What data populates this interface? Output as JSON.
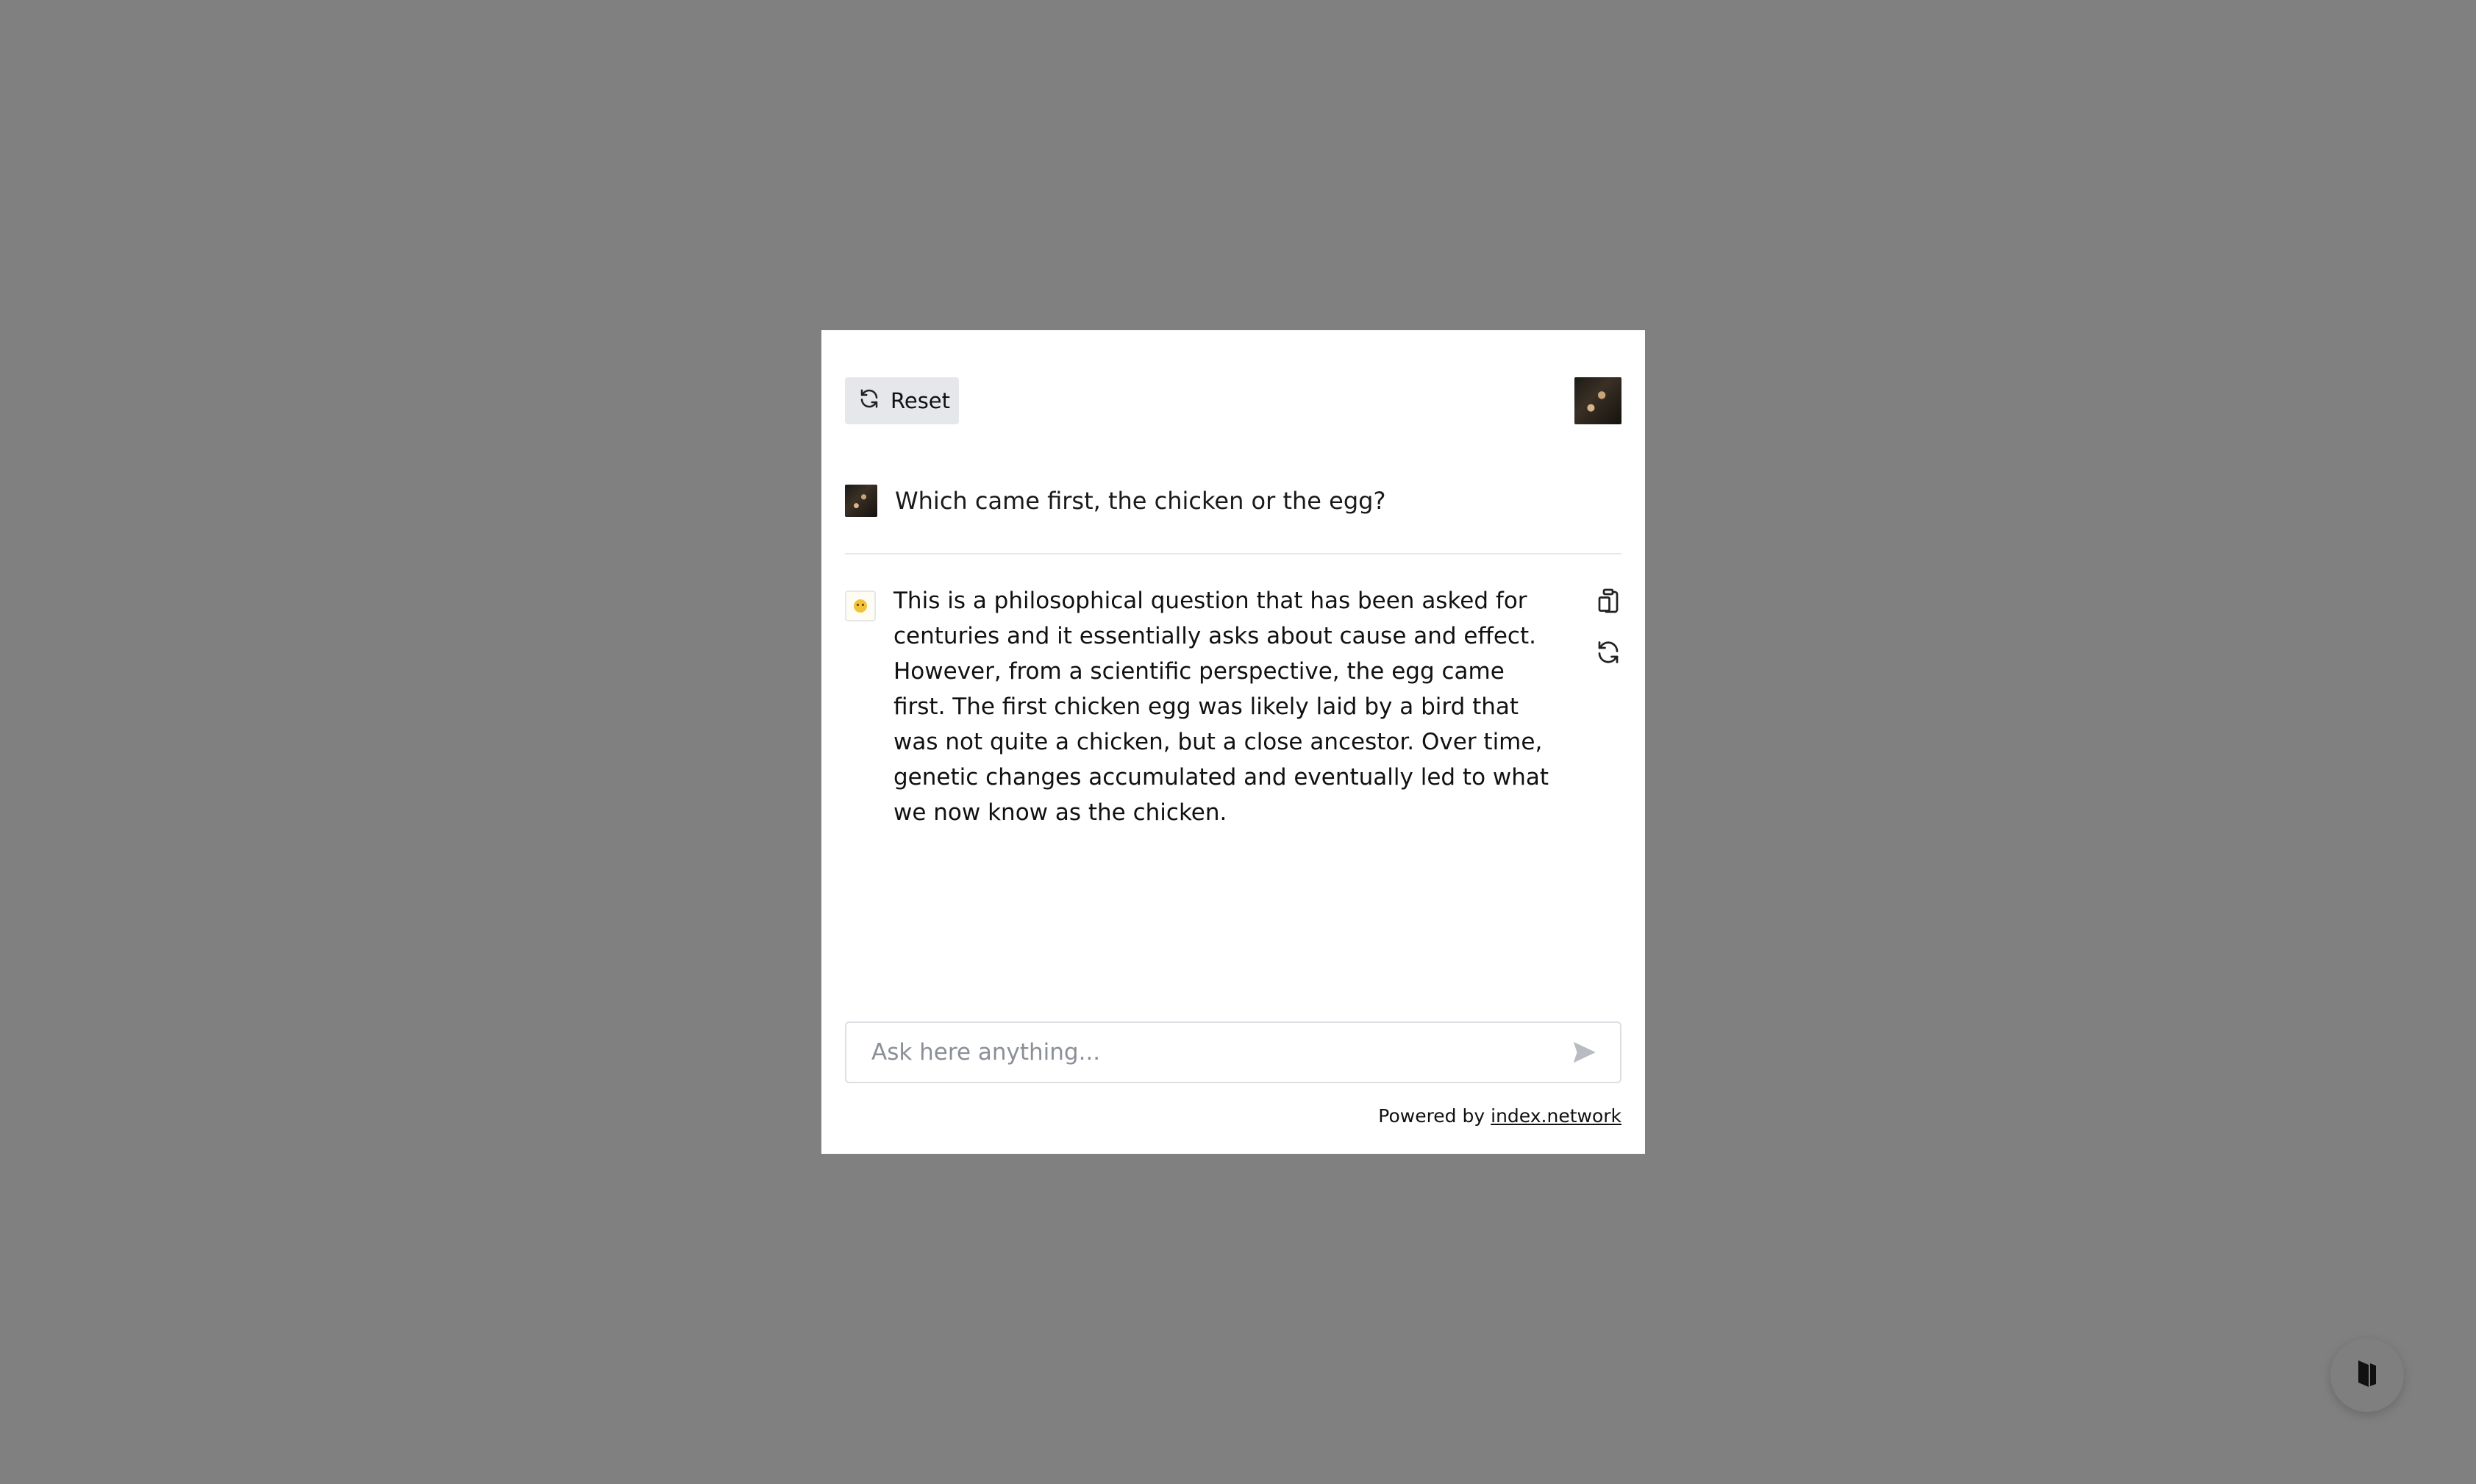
{
  "header": {
    "reset_label": "Reset",
    "reset_icon": "refresh-icon",
    "avatar_icon": "user-avatar"
  },
  "conversation": {
    "user_message": "Which came first, the chicken or the egg?",
    "assistant_message": "This is a philosophical question that has been asked for centuries and it essentially asks about cause and effect. However, from a scientific perspective, the egg came first. The first chicken egg was likely laid by a bird that was not quite a chicken, but a close ancestor. Over time, genetic changes accumulated and eventually led to what we now know as the chicken.",
    "actions": [
      "copy-icon",
      "regenerate-icon"
    ]
  },
  "input": {
    "placeholder": "Ask here anything...",
    "value": "",
    "send_icon": "send-icon"
  },
  "footer": {
    "prefix": "Powered by",
    "link_text": "index.network"
  },
  "colors": {
    "backdrop": "#808080",
    "panel": "#ffffff",
    "button_bg": "#e5e7eb",
    "text": "#111111",
    "placeholder": "#8b8f96"
  }
}
